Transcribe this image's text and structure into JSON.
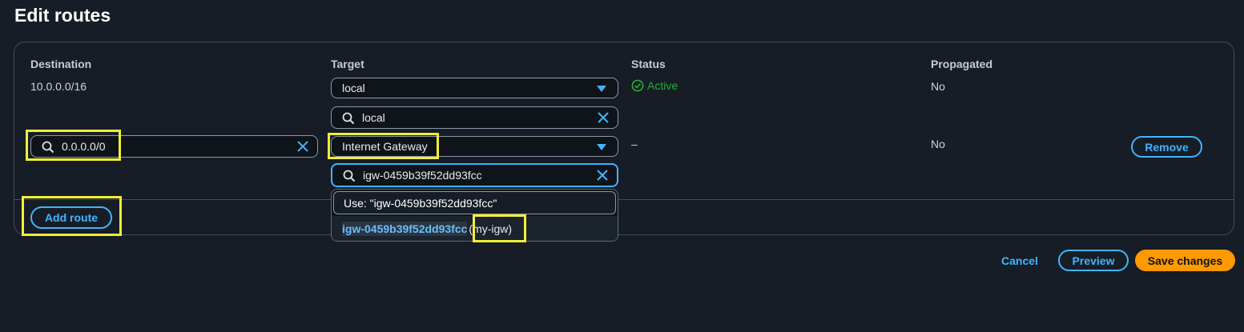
{
  "page": {
    "title": "Edit routes"
  },
  "columns": {
    "destination": "Destination",
    "target": "Target",
    "status": "Status",
    "propagated": "Propagated"
  },
  "routes": [
    {
      "destination": "10.0.0.0/16",
      "target_value": "local",
      "target_search": "local",
      "status": "Active",
      "propagated": "No"
    },
    {
      "destination": "0.0.0.0/0",
      "target_value": "Internet Gateway",
      "target_search": "igw-0459b39f52dd93fcc",
      "status": "–",
      "propagated": "No",
      "remove_label": "Remove"
    }
  ],
  "target_dropdown": {
    "use_option": "Use: \"igw-0459b39f52dd93fcc\"",
    "match_id": "igw-0459b39f52dd93fcc",
    "match_name": "(my-igw)"
  },
  "actions": {
    "add_route": "Add route",
    "cancel": "Cancel",
    "preview": "Preview",
    "save": "Save changes"
  },
  "colors": {
    "background": "#161d26",
    "accent": "#42b4ff",
    "success": "#29ad32",
    "primary_button": "#ff9900",
    "highlight": "#f2ee3a"
  },
  "icons": {
    "status_active": "check-circle-icon",
    "search": "search-icon",
    "clear": "close-icon",
    "caret": "caret-down-icon"
  }
}
